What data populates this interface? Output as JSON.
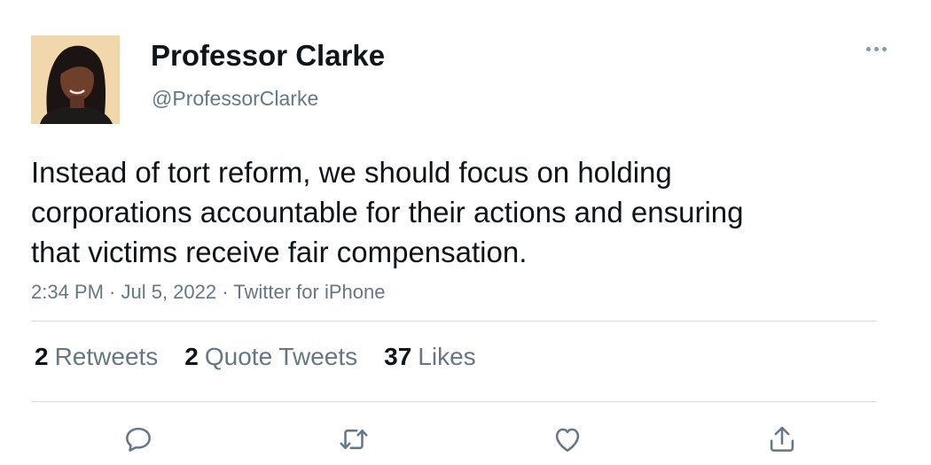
{
  "user": {
    "display_name": "Professor Clarke",
    "handle": "@ProfessorClarke"
  },
  "tweet": {
    "text": "Instead of tort reform, we should focus on holding corporations accountable for their actions and ensuring that victims receive fair compensation.",
    "meta": "2:34 PM · Jul 5, 2022 · Twitter for iPhone"
  },
  "stats": {
    "retweets_count": "2",
    "retweets_label": "Retweets",
    "quotes_count": "2",
    "quotes_label": "Quote Tweets",
    "likes_count": "37",
    "likes_label": "Likes"
  },
  "actions": {
    "icons": [
      "reply-icon",
      "retweet-icon",
      "like-icon",
      "share-icon"
    ],
    "icon_color": "#657786"
  },
  "more_icon": "more-options-icon"
}
